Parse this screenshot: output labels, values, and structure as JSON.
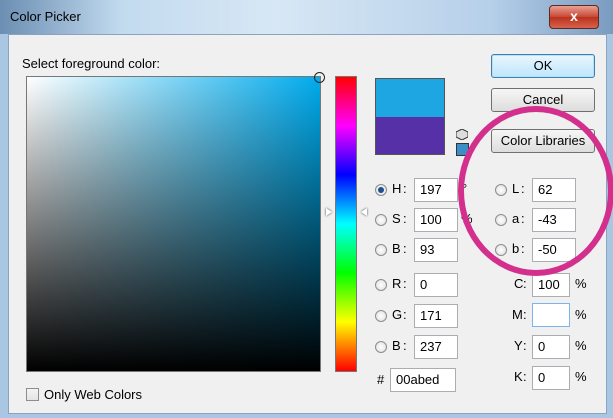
{
  "window": {
    "title": "Color Picker",
    "close": "x"
  },
  "prompt": "Select foreground color:",
  "buttons": {
    "ok": "OK",
    "cancel": "Cancel",
    "libraries": "Color Libraries"
  },
  "colors": {
    "new": "#1ea6e3",
    "old": "#5530a6",
    "hue": "#00abed",
    "annotation": "#d3308d"
  },
  "hsb": [
    {
      "key": "H",
      "value": "197",
      "unit": "°",
      "selected": true
    },
    {
      "key": "S",
      "value": "100",
      "unit": "%",
      "selected": false
    },
    {
      "key": "B",
      "value": "93",
      "unit": "%",
      "selected": false
    }
  ],
  "rgb": [
    {
      "key": "R",
      "value": "0"
    },
    {
      "key": "G",
      "value": "171"
    },
    {
      "key": "B",
      "value": "237"
    }
  ],
  "lab": [
    {
      "key": "L",
      "value": "62"
    },
    {
      "key": "a",
      "value": "-43"
    },
    {
      "key": "b",
      "value": "-50"
    }
  ],
  "cmyk": [
    {
      "key": "C",
      "value": "100",
      "unit": "%"
    },
    {
      "key": "M",
      "value": "",
      "unit": "%"
    },
    {
      "key": "Y",
      "value": "0",
      "unit": "%"
    },
    {
      "key": "K",
      "value": "0",
      "unit": "%"
    }
  ],
  "hex": {
    "prefix": "#",
    "value": "00abed"
  },
  "web_only": {
    "label": "Only Web Colors",
    "checked": false
  }
}
